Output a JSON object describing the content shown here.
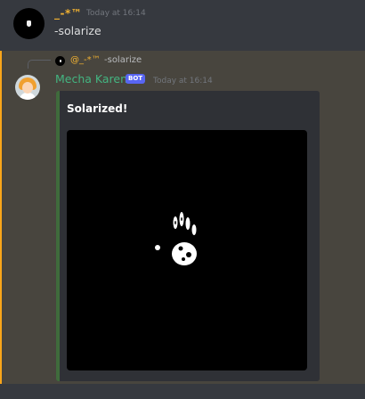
{
  "messages": [
    {
      "username": "_-*™",
      "timestamp": "Today at 16:14",
      "text": "-solarize"
    },
    {
      "reply": {
        "username": "@_-*™",
        "text": "-solarize"
      },
      "username": "Mecha Karen",
      "badge": "BOT",
      "timestamp": "Today at 16:14",
      "embed": {
        "title": "Solarized!",
        "image": "solarized-handprint-image"
      }
    }
  ],
  "colors": {
    "background": "#36393f",
    "highlight": "#48453e",
    "mention_bar": "#faa61a",
    "user1_name": "#f0b132",
    "bot_name": "#43b581",
    "bot_badge": "#5865f2",
    "embed_bg": "#2f3136",
    "embed_border": "#3f6b3c"
  }
}
